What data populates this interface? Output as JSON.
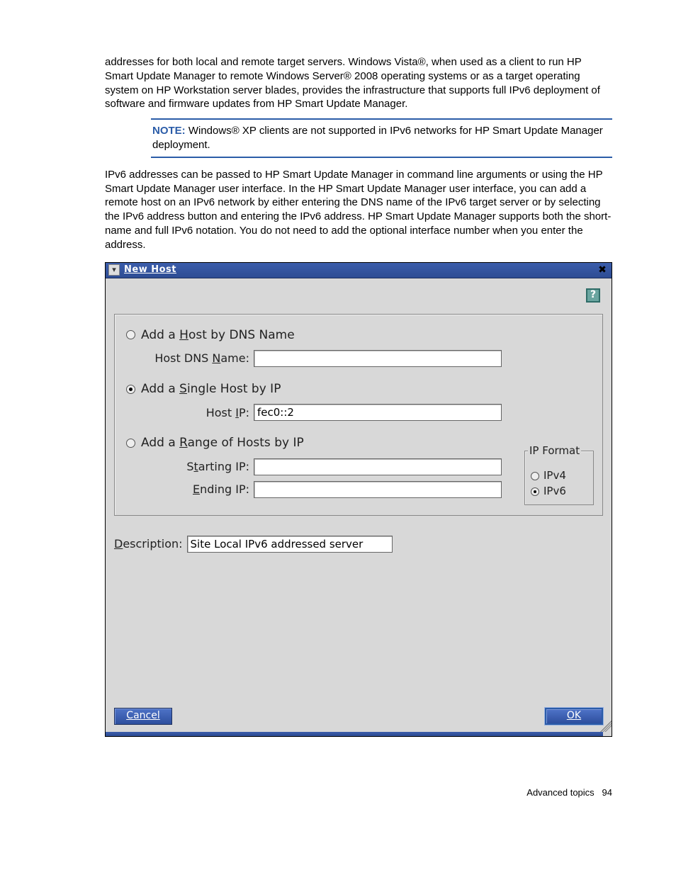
{
  "doc": {
    "para1": "addresses for both local and remote target servers. Windows Vista®, when used as a client to run HP Smart Update Manager to remote Windows Server® 2008 operating systems or as a target operating system on HP Workstation server blades, provides the infrastructure that supports full IPv6 deployment of software and firmware updates from HP Smart Update Manager.",
    "note_label": "NOTE:",
    "note_text": " Windows® XP clients are not supported in IPv6 networks for HP Smart Update Manager deployment.",
    "para2": "IPv6 addresses can be passed to HP Smart Update Manager in command line arguments or using the HP Smart Update Manager user interface. In the HP Smart Update Manager user interface, you can add a remote host on an IPv6 network by either entering the DNS name of the IPv6 target server or by selecting the IPv6 address button and entering the IPv6 address. HP Smart Update Manager supports both the short-name and full IPv6 notation. You do not need to add the optional interface number when you enter the address."
  },
  "dialog": {
    "title": "New Host",
    "options": {
      "dns": {
        "label": "Add a Host by DNS Name",
        "field_label": "Host DNS Name:",
        "value": ""
      },
      "single": {
        "label": "Add a Single Host by IP",
        "field_label": "Host IP:",
        "value": "fec0::2"
      },
      "range": {
        "label": "Add a Range of Hosts by IP",
        "start_label": "Starting IP:",
        "start_value": "",
        "end_label": "Ending IP:",
        "end_value": ""
      }
    },
    "ipformat": {
      "legend": "IP Format",
      "ipv4": "IPv4",
      "ipv6": "IPv6",
      "selected": "ipv6"
    },
    "description_label": "Description:",
    "description_value": "Site Local IPv6 addressed server",
    "buttons": {
      "cancel": "Cancel",
      "ok": "OK"
    }
  },
  "footer": {
    "section": "Advanced topics",
    "page": "94"
  }
}
